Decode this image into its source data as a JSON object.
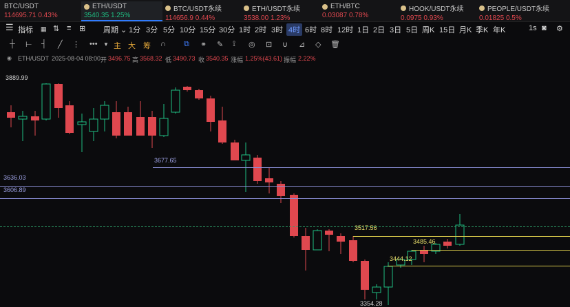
{
  "tickers": [
    {
      "name": "BTC/USDT",
      "price": "114695.71",
      "change": "0.43%",
      "dir": "red",
      "active": false
    },
    {
      "name": "ETH/USDT",
      "price": "3540.35",
      "change": "1.25%",
      "dir": "green",
      "active": true
    },
    {
      "name": "BTC/USDT永续",
      "price": "114656.9",
      "change": "0.44%",
      "dir": "red",
      "active": false
    },
    {
      "name": "ETH/USDT永续",
      "price": "3538.00",
      "change": "1.23%",
      "dir": "red",
      "active": false
    },
    {
      "name": "ETH/BTC",
      "price": "0.03087",
      "change": "0.78%",
      "dir": "red",
      "active": false
    },
    {
      "name": "HOOK/USDT永续",
      "price": "0.0975",
      "change": "0.93%",
      "dir": "red",
      "active": false
    },
    {
      "name": "PEOPLE/USDT永续",
      "price": "0.01825",
      "change": "0.5%",
      "dir": "red",
      "active": false
    }
  ],
  "toolbar": {
    "indicator_label": "指标",
    "period_label": "周期",
    "timeframes": [
      "1分",
      "3分",
      "5分",
      "10分",
      "15分",
      "30分",
      "1时",
      "2时",
      "3时",
      "4时",
      "6时",
      "8时",
      "12时",
      "1日",
      "2日",
      "3日",
      "5日",
      "周K",
      "15日",
      "月K",
      "季K",
      "年K"
    ],
    "selected_timeframe": "4时",
    "right_label": "1s"
  },
  "tools": {
    "main": "主",
    "big": "大",
    "chip": "筹",
    "more": "•••"
  },
  "info": {
    "symbol": "ETH/USDT",
    "datetime": "2025-08-04 08:00",
    "open_label": "开",
    "open": "3496.75",
    "high_label": "高",
    "high": "3568.32",
    "low_label": "低",
    "low": "3490.73",
    "close_label": "收",
    "close": "3540.35",
    "change_label": "涨幅",
    "change": "1.25%(43.61)",
    "amp_label": "振幅",
    "amp": "2.22%"
  },
  "price_labels": {
    "top": "3889.99",
    "l1": "3677.65",
    "l2": "3636.03",
    "l3": "3606.89",
    "l4": "3517.56",
    "l5": "3485.46",
    "l6": "3444.12",
    "low": "3354.28"
  },
  "colors": {
    "up": "#1fbf83",
    "down": "#e0484f",
    "accent": "#2f7bff",
    "hline": "#8b8fd6",
    "yline": "#d8c94a",
    "dash": "#2fa36b"
  }
}
